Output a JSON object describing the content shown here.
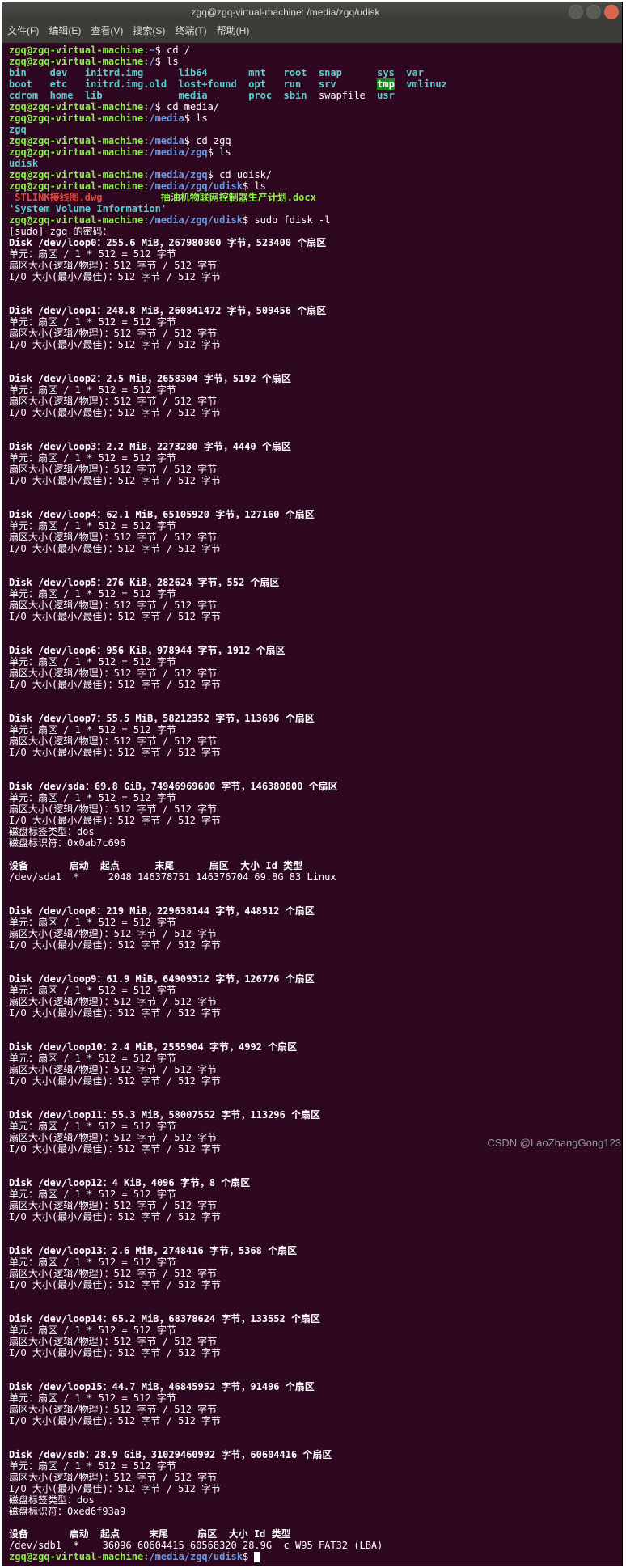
{
  "title": "zgq@zgq-virtual-machine: /media/zgq/udisk",
  "menubar": [
    "文件(F)",
    "编辑(E)",
    "查看(V)",
    "搜索(S)",
    "终端(T)",
    "帮助(H)"
  ],
  "session": {
    "user_host": "zgq@zgq-virtual-machine",
    "home": "~",
    "root": "/",
    "media": "/media",
    "media_zgq": "/media/zgq",
    "udisk": "/media/zgq/udisk",
    "cmd_cd_root": "cd /",
    "cmd_ls": "ls",
    "cmd_cd_media": "cd media/",
    "cmd_cd_zgq": "cd zgq",
    "cmd_cd_udisk": "cd udisk/",
    "cmd_fdisk": "sudo fdisk -l",
    "root_ls": {
      "r1": [
        "bin",
        "dev",
        "initrd.img",
        "lib64",
        "mnt",
        "root",
        "snap",
        "sys",
        "var"
      ],
      "r2": [
        "boot",
        "etc",
        "initrd.img.old",
        "lost+found",
        "opt",
        "run",
        "srv",
        "tmp",
        "vmlinuz"
      ],
      "r3": [
        "cdrom",
        "home",
        "lib",
        "media",
        "proc",
        "sbin",
        "swapfile",
        "usr"
      ]
    },
    "ls_media": "zgq",
    "ls_zgq": "udisk",
    "ls_udisk": {
      "f1": "STLINK接线图.dwg",
      "svi": "'System Volume Information'",
      "f2": "抽油机物联网控制器生产计划.docx"
    },
    "sudo_prompt": "[sudo] zgq 的密码："
  },
  "disks": [
    {
      "dev": "/dev/loop0",
      "size": "255.6 MiB",
      "bytes": "267980800",
      "sectors": "523400"
    },
    {
      "dev": "/dev/loop1",
      "size": "248.8 MiB",
      "bytes": "260841472",
      "sectors": "509456"
    },
    {
      "dev": "/dev/loop2",
      "size": "2.5 MiB",
      "bytes": "2658304",
      "sectors": "5192"
    },
    {
      "dev": "/dev/loop3",
      "size": "2.2 MiB",
      "bytes": "2273280",
      "sectors": "4440"
    },
    {
      "dev": "/dev/loop4",
      "size": "62.1 MiB",
      "bytes": "65105920",
      "sectors": "127160"
    },
    {
      "dev": "/dev/loop5",
      "size": "276 KiB",
      "bytes": "282624",
      "sectors": "552"
    },
    {
      "dev": "/dev/loop6",
      "size": "956 KiB",
      "bytes": "978944",
      "sectors": "1912"
    },
    {
      "dev": "/dev/loop7",
      "size": "55.5 MiB",
      "bytes": "58212352",
      "sectors": "113696"
    },
    {
      "dev": "/dev/sda",
      "size": "69.8 GiB",
      "bytes": "74946969600",
      "sectors": "146380800",
      "labeltype": "dos",
      "id": "0x0ab7c696",
      "table_hdr": "设备       启动  起点      末尾      扇区  大小 Id 类型",
      "table_row": "/dev/sda1  *     2048 146378751 146376704 69.8G 83 Linux"
    },
    {
      "dev": "/dev/loop8",
      "size": "219 MiB",
      "bytes": "229638144",
      "sectors": "448512"
    },
    {
      "dev": "/dev/loop9",
      "size": "61.9 MiB",
      "bytes": "64909312",
      "sectors": "126776"
    },
    {
      "dev": "/dev/loop10",
      "size": "2.4 MiB",
      "bytes": "2555904",
      "sectors": "4992"
    },
    {
      "dev": "/dev/loop11",
      "size": "55.3 MiB",
      "bytes": "58007552",
      "sectors": "113296"
    },
    {
      "dev": "/dev/loop12",
      "size": "4 KiB",
      "bytes": "4096",
      "sectors": "8"
    },
    {
      "dev": "/dev/loop13",
      "size": "2.6 MiB",
      "bytes": "2748416",
      "sectors": "5368"
    },
    {
      "dev": "/dev/loop14",
      "size": "65.2 MiB",
      "bytes": "68378624",
      "sectors": "133552"
    },
    {
      "dev": "/dev/loop15",
      "size": "44.7 MiB",
      "bytes": "46845952",
      "sectors": "91496"
    },
    {
      "dev": "/dev/sdb",
      "size": "28.9 GiB",
      "bytes": "31029460992",
      "sectors": "60604416",
      "labeltype": "dos",
      "id": "0xed6f93a9",
      "table_hdr": "设备       启动  起点     末尾     扇区  大小 Id 类型",
      "table_row": "/dev/sdb1  *    36096 60604415 60568320 28.9G  c W95 FAT32 (LBA)"
    }
  ],
  "strings": {
    "unit": "单元：扇区 / 1 * 512 = 512 字节",
    "sector": "扇区大小(逻辑/物理)：512 字节 / 512 字节",
    "io": "I/O 大小(最小/最佳)：512 字节 / 512 字节",
    "label": "磁盘标签类型：",
    "ident": "磁盘标识符：",
    "bytes": "字节",
    "sectors": "个扇区",
    "disk": "Disk"
  },
  "watermark": "CSDN @LaoZhangGong123"
}
